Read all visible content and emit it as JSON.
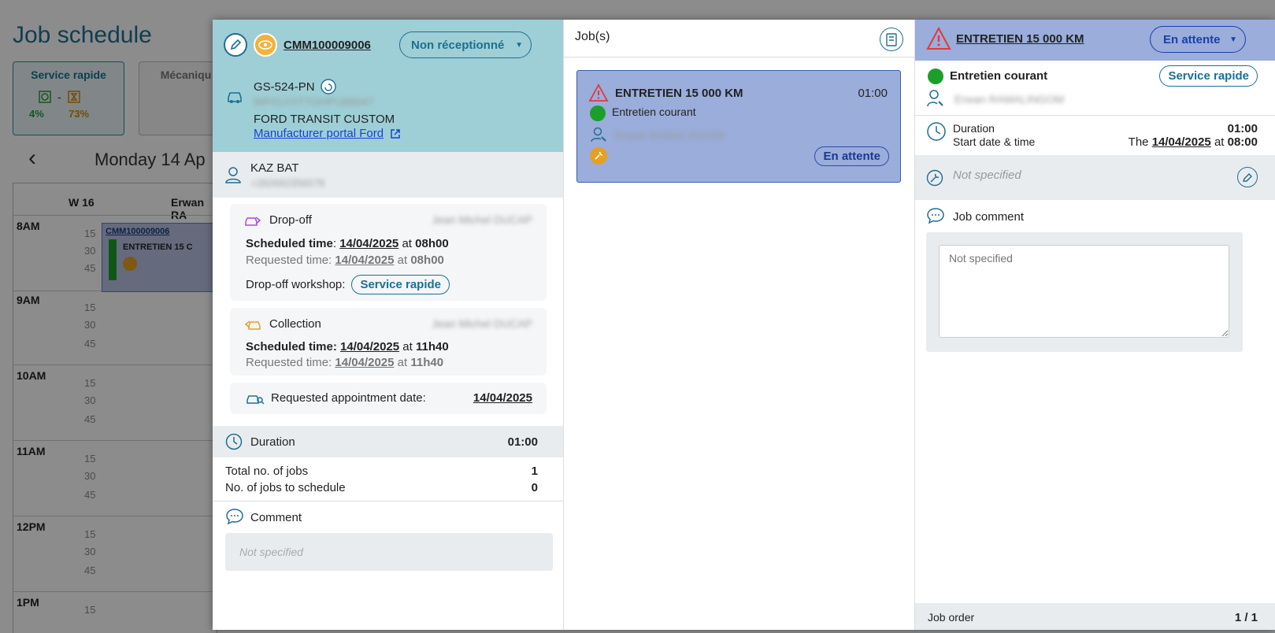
{
  "background": {
    "title": "Job schedule",
    "workshops": [
      {
        "name": "Service rapide",
        "pct_a": "4%",
        "pct_b": "73%",
        "sep": "-"
      },
      {
        "name": "Mécaniqu"
      }
    ],
    "nav_prev": "‹",
    "date": "Monday 14 Ap",
    "week": "W 16",
    "column": "Erwan RA",
    "hours": [
      "8AM",
      "9AM",
      "10AM",
      "11AM",
      "12PM",
      "1PM"
    ],
    "minutes": [
      "15",
      "30",
      "45"
    ],
    "event": {
      "code": "CMM100009006",
      "name": "ENTRETIEN 15 C"
    }
  },
  "order": {
    "code": "CMM100009006",
    "status": "Non réceptionné",
    "plate": "GS-524-PN",
    "vin": "WF01XXTTGHPU86647",
    "model": "FORD TRANSIT CUSTOM",
    "portal_link": "Manufacturer portal Ford",
    "customer_name": "KAZ BAT",
    "customer_phone": "+262692356578",
    "dropoff": {
      "title": "Drop-off",
      "person": "Jean Michel DUCAP",
      "sched_label": "Scheduled time",
      "sched_colon": ":",
      "sched_date": "14/04/2025",
      "at": "at",
      "sched_time": "08h00",
      "req_label": "Requested time:",
      "req_date": "14/04/2025",
      "req_time": "08h00",
      "workshop_label": "Drop-off workshop:",
      "workshop": "Service rapide"
    },
    "collection": {
      "title": "Collection",
      "person": "Jean Michel DUCAP",
      "sched_label": "Scheduled time:",
      "sched_date": "14/04/2025",
      "at": "at",
      "sched_time": "11h40",
      "req_label": "Requested time:",
      "req_date": "14/04/2025",
      "req_time": "11h40"
    },
    "appointment": {
      "label": "Requested appointment date:",
      "date": "14/04/2025"
    },
    "duration": {
      "label": "Duration",
      "value": "01:00"
    },
    "total_jobs": {
      "label": "Total no. of jobs",
      "value": "1"
    },
    "jobs_to_schedule": {
      "label": "No. of jobs to schedule",
      "value": "0"
    },
    "comment": {
      "label": "Comment",
      "placeholder": "Not specified"
    }
  },
  "jobs": {
    "title": "Job(s)",
    "items": [
      {
        "name": "ENTRETIEN 15 000 KM",
        "time": "01:00",
        "type": "Entretien courant",
        "technician": "Erwan RAMALINGOM",
        "status": "En attente"
      }
    ]
  },
  "job_detail": {
    "title": "ENTRETIEN 15 000 KM",
    "status": "En attente",
    "type": "Entretien courant",
    "workshop": "Service rapide",
    "technician": "Erwan RAMALINGOM",
    "duration_label": "Duration",
    "duration": "01:00",
    "start_label": "Start date & time",
    "start_prefix": "The",
    "start_date": "14/04/2025",
    "start_at": "at",
    "start_time": "08:00",
    "operation_placeholder": "Not specified",
    "comment_label": "Job comment",
    "comment_placeholder": "Not specified",
    "order_label": "Job order",
    "order_value": "1 / 1"
  },
  "colors": {
    "accent": "#1e6f92",
    "header_teal": "#9ecfd6",
    "job_blue": "#9aaddb",
    "warn": "#e03a3a",
    "ok": "#1aa02a",
    "tool": "#e6a020"
  }
}
